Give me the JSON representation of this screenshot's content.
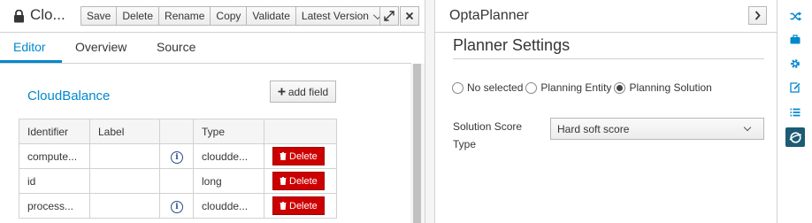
{
  "editor": {
    "title": "Clo...",
    "toolbar": {
      "save": "Save",
      "delete": "Delete",
      "rename": "Rename",
      "copy": "Copy",
      "validate": "Validate",
      "latest_version": "Latest Version"
    },
    "tabs": [
      "Editor",
      "Overview",
      "Source"
    ],
    "active_tab": "Editor",
    "entity_name": "CloudBalance",
    "add_field_label": "add field",
    "table": {
      "headers": [
        "Identifier",
        "Label",
        "",
        "Type",
        ""
      ],
      "rows": [
        {
          "identifier": "compute...",
          "label": "",
          "info": true,
          "type": "cloudde...",
          "action": "Delete"
        },
        {
          "identifier": "id",
          "label": "",
          "info": false,
          "type": "long",
          "action": "Delete"
        },
        {
          "identifier": "process...",
          "label": "",
          "info": true,
          "type": "cloudde...",
          "action": "Delete"
        }
      ]
    }
  },
  "planner": {
    "panel_title": "OptaPlanner",
    "section_title": "Planner Settings",
    "radio_options": [
      "No selected",
      "Planning Entity",
      "Planning Solution"
    ],
    "selected_option": "Planning Solution",
    "score_label": "Solution Score Type",
    "score_value": "Hard soft score"
  },
  "colors": {
    "accent": "#0088ce",
    "delete": "#cc0000",
    "active_icon_bg": "#1c5b73"
  },
  "icon_bar": [
    "shuffle-icon",
    "briefcase-icon",
    "gear-icon",
    "edit-icon",
    "list-icon",
    "optaplanner-icon"
  ]
}
